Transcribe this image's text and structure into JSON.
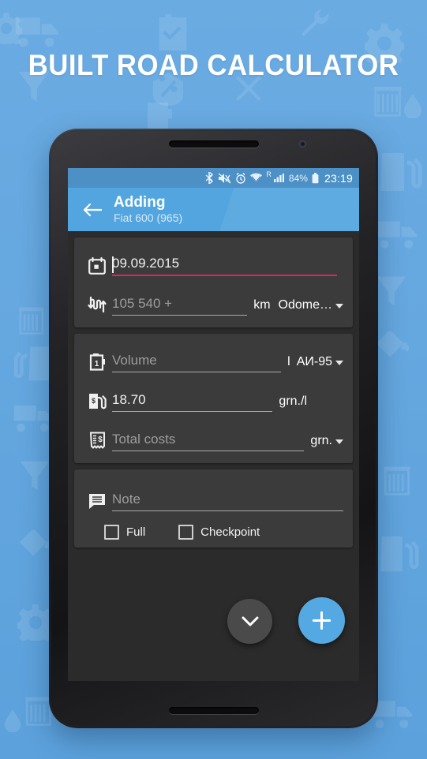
{
  "promo": {
    "title": "BUILT ROAD CALCULATOR",
    "bg_color": "#65a7df",
    "title_color": "#ffffff"
  },
  "statusbar": {
    "bluetooth_icon": "bluetooth-icon",
    "mute_icon": "volume-mute-icon",
    "alarm_icon": "alarm-clock-icon",
    "wifi_icon": "wifi-icon",
    "roaming_label": "R",
    "signal_icon": "cellular-signal-icon",
    "battery_percent": "84%",
    "battery_icon": "battery-icon",
    "clock": "23:19",
    "bg_color": "#4d90c6"
  },
  "appbar": {
    "back_icon": "arrow-back-icon",
    "title": "Adding",
    "subtitle": "Fiat 600 (965)",
    "bg_color": "#52a5df"
  },
  "cards": [
    {
      "name": "date-odometer-card",
      "rows": [
        {
          "icon": "calendar-icon",
          "value": "09.09.2015",
          "is_placeholder": false,
          "focused": true,
          "unit": "",
          "spinner": ""
        },
        {
          "icon": "odometer-icon",
          "value": "105 540 +",
          "is_placeholder": true,
          "focused": false,
          "unit": "km",
          "spinner": "Odome…"
        }
      ]
    },
    {
      "name": "fuel-card",
      "rows": [
        {
          "icon": "jerrycan-icon",
          "value": "Volume",
          "is_placeholder": true,
          "focused": false,
          "unit": "l",
          "spinner": "АИ-95"
        },
        {
          "icon": "fuel-pump-icon",
          "value": "18.70",
          "is_placeholder": false,
          "focused": false,
          "unit": "grn./l",
          "spinner": ""
        },
        {
          "icon": "receipt-icon",
          "value": "Total costs",
          "is_placeholder": true,
          "focused": false,
          "unit": "",
          "spinner": "grn."
        }
      ]
    }
  ],
  "note_card": {
    "icon": "note-icon",
    "placeholder": "Note",
    "value": "",
    "checkboxes": [
      {
        "label": "Full",
        "checked": false
      },
      {
        "label": "Checkpoint",
        "checked": false
      }
    ]
  },
  "fabs": {
    "collapse": {
      "icon": "chevron-down-icon",
      "color": "#4a4a4a"
    },
    "add": {
      "icon": "plus-icon",
      "color": "#54a9e2"
    }
  },
  "colors": {
    "accent_pink": "#e0245e",
    "card_bg": "#3b3b3b",
    "screen_bg": "#2b2b2b"
  }
}
